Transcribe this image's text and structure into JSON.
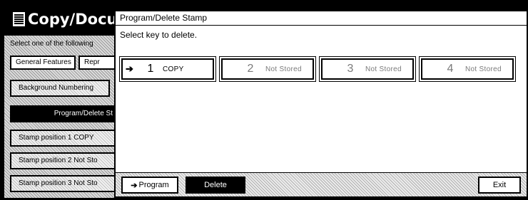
{
  "background": {
    "title": "Copy/Docu",
    "instruction": "Select one of the following",
    "tabs": [
      "General Features",
      "Repr"
    ],
    "items": [
      "Background Numbering",
      "Program/Delete St",
      "Stamp position 1 COPY",
      "Stamp position 2 Not Sto",
      "Stamp position 3 Not Sto"
    ]
  },
  "dialog": {
    "title": "Program/Delete Stamp",
    "message": "Select key to delete.",
    "stamps": [
      {
        "number": "1",
        "label": "COPY",
        "selected": true
      },
      {
        "number": "2",
        "label": "Not Stored",
        "selected": false
      },
      {
        "number": "3",
        "label": "Not Stored",
        "selected": false
      },
      {
        "number": "4",
        "label": "Not Stored",
        "selected": false
      }
    ],
    "buttons": {
      "program": "Program",
      "delete": "Delete",
      "exit": "Exit"
    },
    "icons": {
      "arrow": "➔"
    }
  }
}
